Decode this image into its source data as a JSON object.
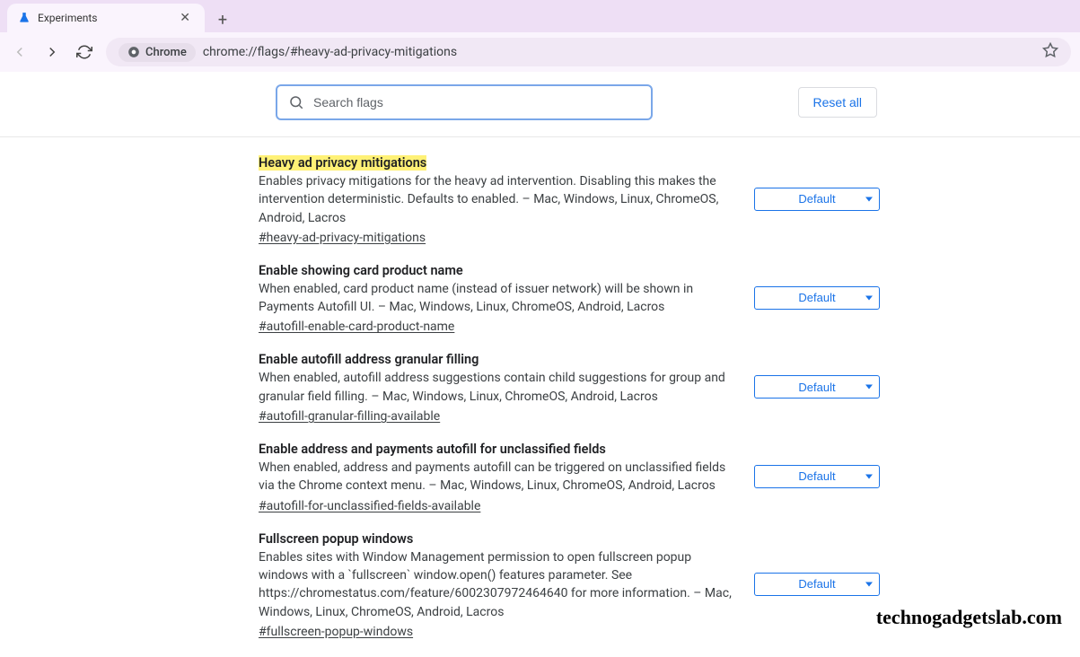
{
  "browser": {
    "tab_title": "Experiments",
    "url": "chrome://flags/#heavy-ad-privacy-mitigations",
    "omnibox_label": "Chrome"
  },
  "search": {
    "placeholder": "Search flags"
  },
  "reset_label": "Reset all",
  "flags": [
    {
      "title": "Heavy ad privacy mitigations",
      "highlight": true,
      "description": "Enables privacy mitigations for the heavy ad intervention. Disabling this makes the intervention deterministic. Defaults to enabled. – Mac, Windows, Linux, ChromeOS, Android, Lacros",
      "anchor": "#heavy-ad-privacy-mitigations",
      "value": "Default"
    },
    {
      "title": "Enable showing card product name",
      "highlight": false,
      "description": "When enabled, card product name (instead of issuer network) will be shown in Payments Autofill UI. – Mac, Windows, Linux, ChromeOS, Android, Lacros",
      "anchor": "#autofill-enable-card-product-name",
      "value": "Default"
    },
    {
      "title": "Enable autofill address granular filling",
      "highlight": false,
      "description": "When enabled, autofill address suggestions contain child suggestions for group and granular field filling. – Mac, Windows, Linux, ChromeOS, Android, Lacros",
      "anchor": "#autofill-granular-filling-available",
      "value": "Default"
    },
    {
      "title": "Enable address and payments autofill for unclassified fields",
      "highlight": false,
      "description": "When enabled, address and payments autofill can be triggered on unclassified fields via the Chrome context menu. – Mac, Windows, Linux, ChromeOS, Android, Lacros",
      "anchor": "#autofill-for-unclassified-fields-available",
      "value": "Default"
    },
    {
      "title": "Fullscreen popup windows",
      "highlight": false,
      "description": "Enables sites with Window Management permission to open fullscreen popup windows with a `fullscreen` window.open() features parameter. See https://chromestatus.com/feature/6002307972464640 for more information. – Mac, Windows, Linux, ChromeOS, Android, Lacros",
      "anchor": "#fullscreen-popup-windows",
      "value": "Default"
    }
  ],
  "watermark": "technogadgetslab.com"
}
